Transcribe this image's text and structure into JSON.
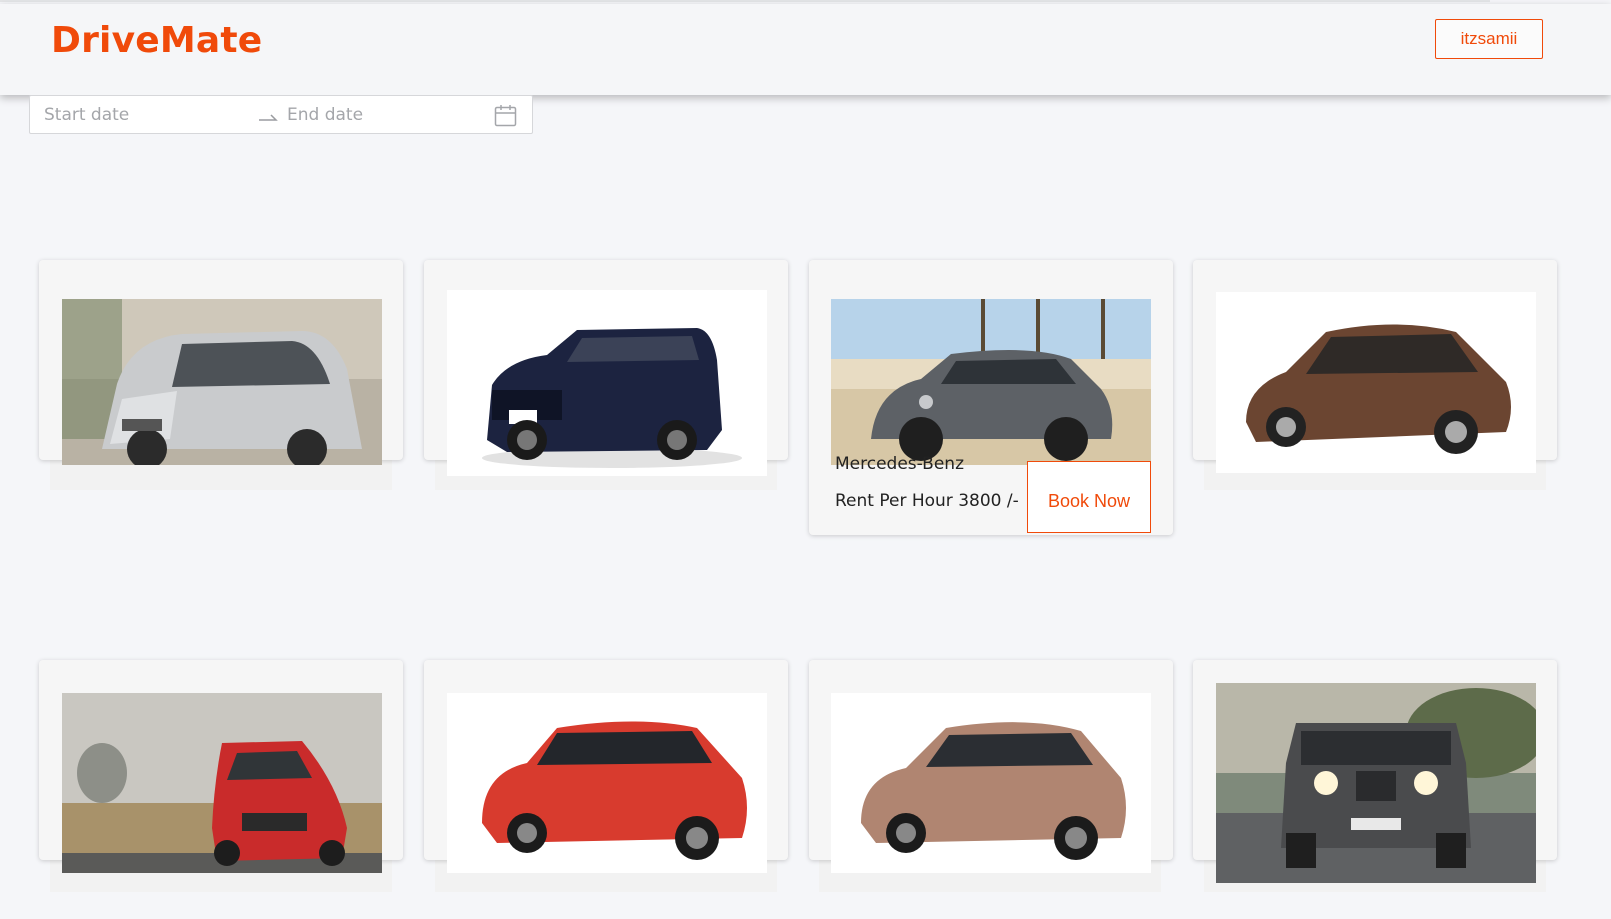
{
  "header": {
    "brand": "DriveMate",
    "user_button": "itzsamii"
  },
  "date_range": {
    "start_placeholder": "Start date",
    "end_placeholder": "End date"
  },
  "cars": [
    {
      "id": "car-1",
      "image": "silver-hatchback"
    },
    {
      "id": "car-2",
      "image": "navy-suv"
    },
    {
      "id": "car-3",
      "image": "grey-sedan",
      "name": "Mercedes-Benz",
      "rent": "Rent Per Hour 3800 /-",
      "book": "Book Now"
    },
    {
      "id": "car-4",
      "image": "brown-sedan"
    },
    {
      "id": "car-5",
      "image": "red-hatchback"
    },
    {
      "id": "car-6",
      "image": "red-crossover"
    },
    {
      "id": "car-7",
      "image": "bronze-coupe-suv"
    },
    {
      "id": "car-8",
      "image": "grey-offroader"
    }
  ],
  "colors": {
    "accent": "#f04a0a",
    "background": "#f5f6f9"
  }
}
